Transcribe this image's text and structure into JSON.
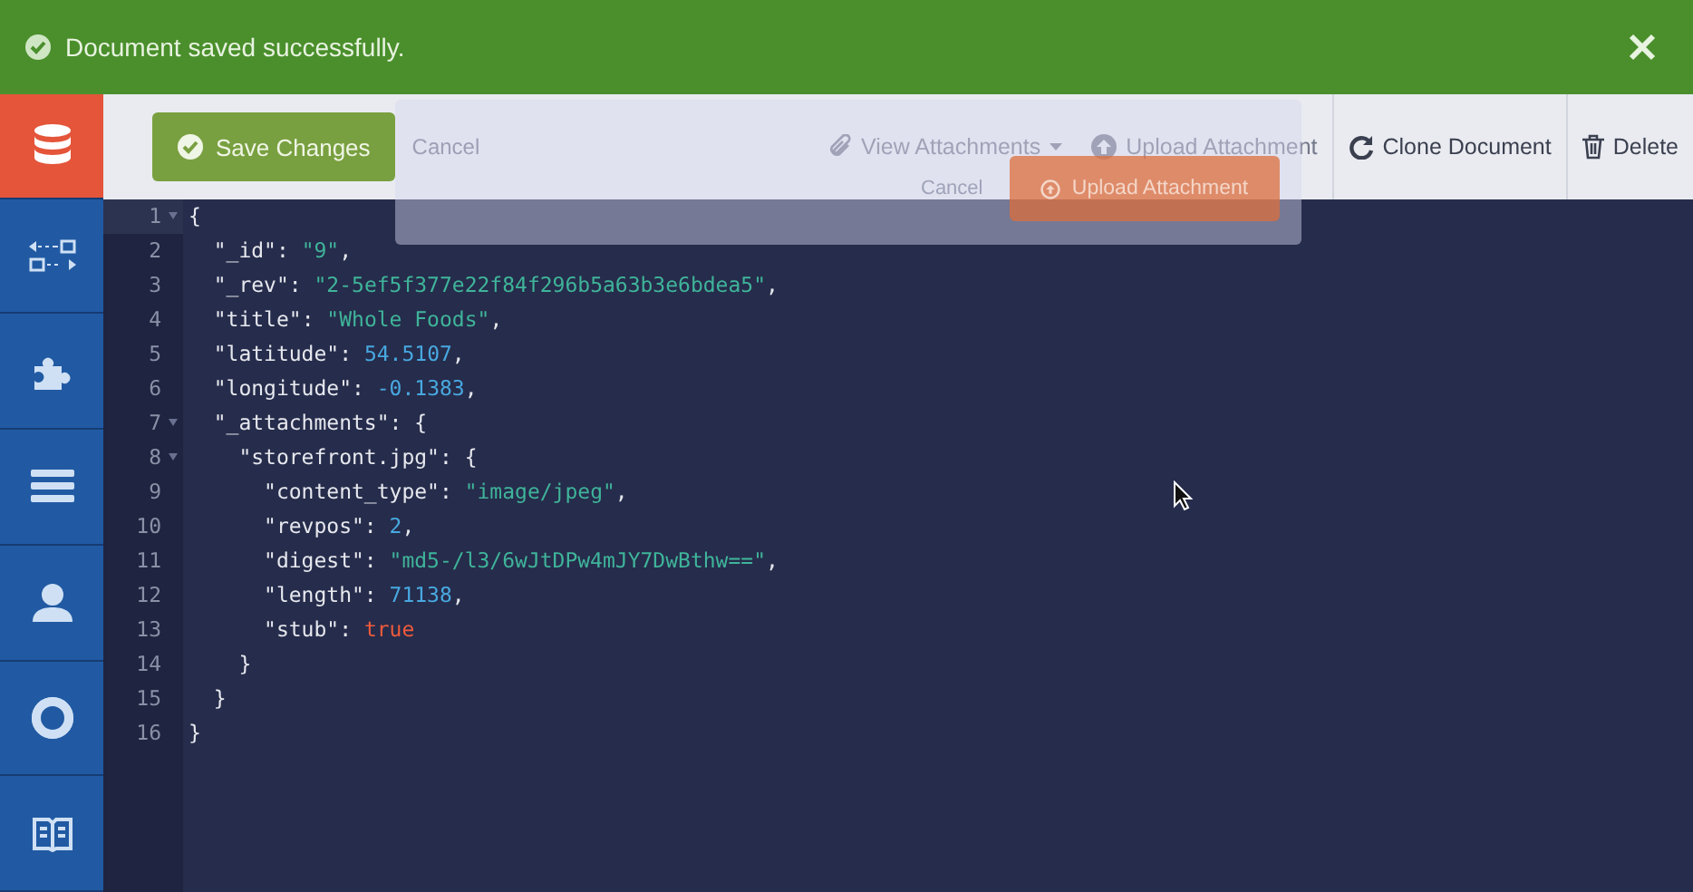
{
  "notification": {
    "message": "Document saved successfully."
  },
  "sidebar": {
    "items": [
      {
        "kind": "database",
        "selected": true
      },
      {
        "kind": "replication",
        "selected": false
      },
      {
        "kind": "plugin",
        "selected": false
      },
      {
        "kind": "list",
        "selected": false
      },
      {
        "kind": "user",
        "selected": false
      },
      {
        "kind": "help",
        "selected": false
      },
      {
        "kind": "docs",
        "selected": false
      }
    ]
  },
  "toolbar": {
    "save_button": "Save Changes",
    "cancel": "Cancel",
    "actions": [
      {
        "kind": "attach",
        "label": "View Attachments",
        "disabled": true,
        "caret": true
      },
      {
        "kind": "upload",
        "label": "Upload Attachment",
        "disabled": true,
        "caret": false
      },
      {
        "kind": "clone",
        "label": "Clone Document",
        "disabled": false,
        "caret": false
      },
      {
        "kind": "delete",
        "label": "Delete",
        "disabled": false,
        "caret": false
      }
    ]
  },
  "upload_dialog": {
    "cancel": "Cancel",
    "upload_button": "Upload Attachment"
  },
  "editor": {
    "lines": [
      {
        "number": "1",
        "foldable": true,
        "current": true,
        "tokens": [
          {
            "kind": "punct",
            "text": "{"
          }
        ]
      },
      {
        "number": "2",
        "foldable": false,
        "current": false,
        "tokens": [
          {
            "kind": "key",
            "text": "\"_id\""
          },
          {
            "kind": "punct",
            "text": ": "
          },
          {
            "kind": "string",
            "text": "\"9\""
          },
          {
            "kind": "punct",
            "text": ","
          }
        ]
      },
      {
        "number": "3",
        "foldable": false,
        "current": false,
        "tokens": [
          {
            "kind": "key",
            "text": "\"_rev\""
          },
          {
            "kind": "punct",
            "text": ": "
          },
          {
            "kind": "string",
            "text": "\"2-5ef5f377e22f84f296b5a63b3e6bdea5\""
          },
          {
            "kind": "punct",
            "text": ","
          }
        ]
      },
      {
        "number": "4",
        "foldable": false,
        "current": false,
        "tokens": [
          {
            "kind": "key",
            "text": "\"title\""
          },
          {
            "kind": "punct",
            "text": ": "
          },
          {
            "kind": "string",
            "text": "\"Whole Foods\""
          },
          {
            "kind": "punct",
            "text": ","
          }
        ]
      },
      {
        "number": "5",
        "foldable": false,
        "current": false,
        "tokens": [
          {
            "kind": "key",
            "text": "\"latitude\""
          },
          {
            "kind": "punct",
            "text": ": "
          },
          {
            "kind": "number",
            "text": "54.5107"
          },
          {
            "kind": "punct",
            "text": ","
          }
        ]
      },
      {
        "number": "6",
        "foldable": false,
        "current": false,
        "tokens": [
          {
            "kind": "key",
            "text": "\"longitude\""
          },
          {
            "kind": "punct",
            "text": ": "
          },
          {
            "kind": "number",
            "text": "-0.1383"
          },
          {
            "kind": "punct",
            "text": ","
          }
        ]
      },
      {
        "number": "7",
        "foldable": true,
        "current": false,
        "tokens": [
          {
            "kind": "key",
            "text": "\"_attachments\""
          },
          {
            "kind": "punct",
            "text": ": {"
          }
        ]
      },
      {
        "number": "8",
        "foldable": true,
        "current": false,
        "tokens": [
          {
            "kind": "key",
            "text": "\"storefront.jpg\""
          },
          {
            "kind": "punct",
            "text": ": {"
          }
        ]
      },
      {
        "number": "9",
        "foldable": false,
        "current": false,
        "tokens": [
          {
            "kind": "key",
            "text": "\"content_type\""
          },
          {
            "kind": "punct",
            "text": ": "
          },
          {
            "kind": "string",
            "text": "\"image/jpeg\""
          },
          {
            "kind": "punct",
            "text": ","
          }
        ]
      },
      {
        "number": "10",
        "foldable": false,
        "current": false,
        "tokens": [
          {
            "kind": "key",
            "text": "\"revpos\""
          },
          {
            "kind": "punct",
            "text": ": "
          },
          {
            "kind": "number",
            "text": "2"
          },
          {
            "kind": "punct",
            "text": ","
          }
        ]
      },
      {
        "number": "11",
        "foldable": false,
        "current": false,
        "tokens": [
          {
            "kind": "key",
            "text": "\"digest\""
          },
          {
            "kind": "punct",
            "text": ": "
          },
          {
            "kind": "string",
            "text": "\"md5-/l3/6wJtDPw4mJY7DwBthw==\""
          },
          {
            "kind": "punct",
            "text": ","
          }
        ]
      },
      {
        "number": "12",
        "foldable": false,
        "current": false,
        "tokens": [
          {
            "kind": "key",
            "text": "\"length\""
          },
          {
            "kind": "punct",
            "text": ": "
          },
          {
            "kind": "number",
            "text": "71138"
          },
          {
            "kind": "punct",
            "text": ","
          }
        ]
      },
      {
        "number": "13",
        "foldable": false,
        "current": false,
        "tokens": [
          {
            "kind": "key",
            "text": "\"stub\""
          },
          {
            "kind": "punct",
            "text": ": "
          },
          {
            "kind": "bool",
            "text": "true"
          }
        ]
      },
      {
        "number": "14",
        "foldable": false,
        "current": false,
        "tokens": [
          {
            "kind": "punct",
            "text": "}"
          }
        ]
      },
      {
        "number": "15",
        "foldable": false,
        "current": false,
        "tokens": [
          {
            "kind": "punct",
            "text": "}"
          }
        ]
      },
      {
        "number": "16",
        "foldable": false,
        "current": false,
        "tokens": [
          {
            "kind": "punct",
            "text": "}"
          }
        ]
      }
    ]
  }
}
